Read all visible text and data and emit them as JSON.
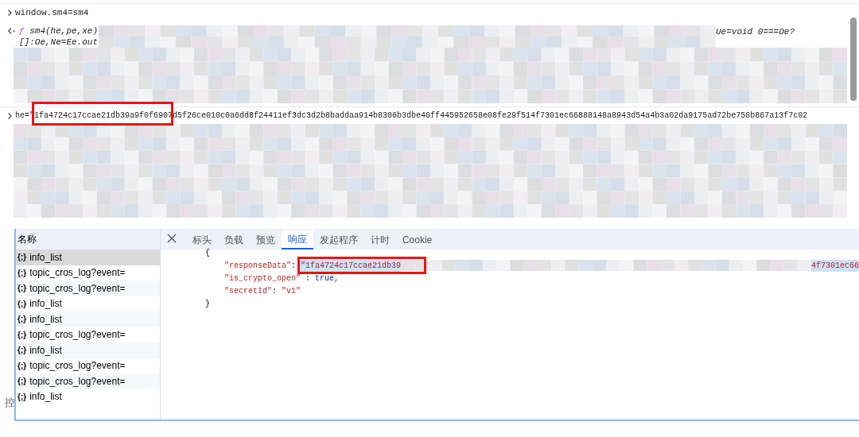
{
  "console": [
    {
      "kind": "input",
      "text": "window.sm4=sm4"
    },
    {
      "kind": "output",
      "prefix": "ƒ",
      "lines": [
        "sm4(he,pe,xe)",
        "[]:Oe,Ne=Ee.out"
      ],
      "tail": "Ue=void 0===Oe?"
    },
    {
      "kind": "input",
      "text": "he=\"1fa4724c17ccae21db39a9f0f6907d5f26ce010c0a6dd8f24411ef3dc3d2b8baddaa914b8306b3dbe40ff445952658e08fe29f514f7301ec66888148a8943d54a4b3a02da9175ad72be758b867a13f7c02"
    }
  ],
  "network": {
    "name_header": "名称",
    "requests": [
      {
        "icon": "{;}",
        "name": "info_list",
        "selected": true
      },
      {
        "icon": "{;}",
        "name": "topic_cros_log?event=",
        "selected": false
      },
      {
        "icon": "{;}",
        "name": "topic_cros_log?event=",
        "selected": false
      },
      {
        "icon": "{;}",
        "name": "info_list",
        "selected": false
      },
      {
        "icon": "{;}",
        "name": "info_list",
        "selected": false
      },
      {
        "icon": "{;}",
        "name": "topic_cros_log?event=",
        "selected": false
      },
      {
        "icon": "{;}",
        "name": "info_list",
        "selected": false
      },
      {
        "icon": "{;}",
        "name": "topic_cros_log?event=",
        "selected": false
      },
      {
        "icon": "{;}",
        "name": "topic_cros_log?event=",
        "selected": false
      },
      {
        "icon": "{;}",
        "name": "info_list",
        "selected": false
      }
    ],
    "tabs": [
      {
        "label": "标头",
        "selected": false
      },
      {
        "label": "负载",
        "selected": false
      },
      {
        "label": "预览",
        "selected": false
      },
      {
        "label": "响应",
        "selected": true
      },
      {
        "label": "发起程序",
        "selected": false
      },
      {
        "label": "计时",
        "selected": false
      },
      {
        "label": "Cookie",
        "selected": false
      }
    ],
    "response": {
      "open": "{",
      "key1": "\"responseData\"",
      "colon1": ":",
      "colon2": ":",
      "colon3": ":",
      "val1_start": "\"1fa4724c17ccae21db39",
      "val1_end": "4f7301ec66",
      "key2": "\"is_crypto_open\"",
      "val2": "true,",
      "key3": "\"secretId\"",
      "val3": "\"v1\"",
      "close": "}"
    }
  },
  "bottom_tab": "控"
}
